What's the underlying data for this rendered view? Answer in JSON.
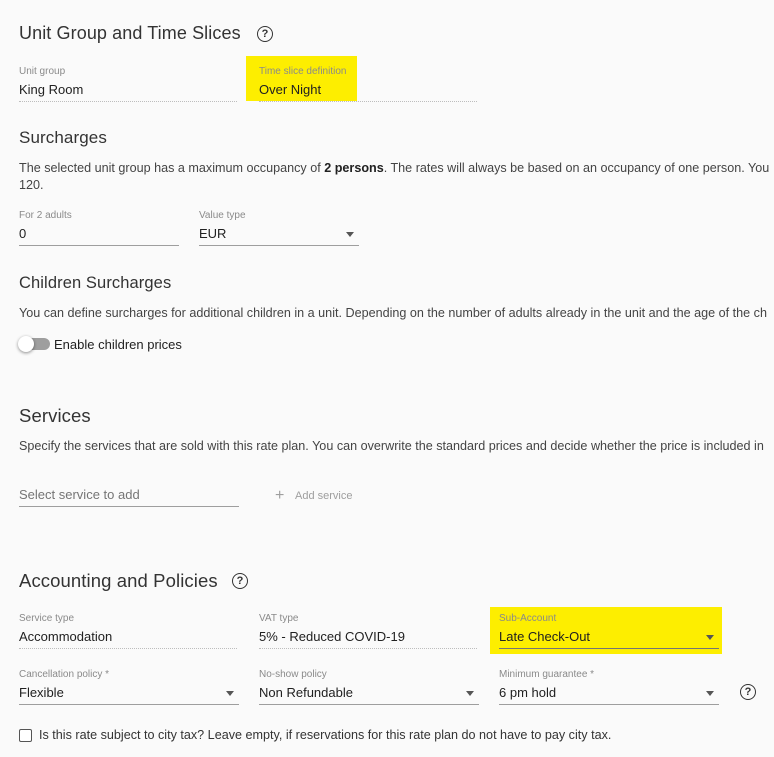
{
  "unit_group_section": {
    "title": "Unit Group and Time Slices",
    "help_icon": "help-circle-icon",
    "unit_group": {
      "label": "Unit group",
      "value": "King Room"
    },
    "time_slice": {
      "label": "Time slice definition",
      "value": "Over Night"
    }
  },
  "surcharges": {
    "title": "Surcharges",
    "desc_before": "The selected unit group has a maximum occupancy of ",
    "desc_bold": "2 persons",
    "desc_after": ". The rates will always be based on an occupancy of one person. You",
    "desc_line2": "120.",
    "for_adults": {
      "label": "For 2 adults",
      "value": "0"
    },
    "value_type": {
      "label": "Value type",
      "value": "EUR"
    }
  },
  "children_surcharges": {
    "title": "Children Surcharges",
    "desc": "You can define surcharges for additional children in a unit. Depending on the number of adults already in the unit and the age of the ch",
    "toggle_label": "Enable children prices"
  },
  "services": {
    "title": "Services",
    "desc": "Specify the services that are sold with this rate plan. You can overwrite the standard prices and decide whether the price is included in",
    "select_placeholder": "Select service to add",
    "add_button": "Add service",
    "add_icon": "plus-icon"
  },
  "accounting": {
    "title": "Accounting and Policies",
    "help_icon": "help-circle-icon",
    "service_type": {
      "label": "Service type",
      "value": "Accommodation"
    },
    "vat_type": {
      "label": "VAT type",
      "value": "5% - Reduced COVID-19"
    },
    "sub_account": {
      "label": "Sub-Account",
      "value": "Late Check-Out"
    },
    "cancellation": {
      "label": "Cancellation policy *",
      "value": "Flexible"
    },
    "no_show": {
      "label": "No-show policy",
      "value": "Non Refundable"
    },
    "min_guarantee": {
      "label": "Minimum guarantee *",
      "value": "6 pm hold"
    },
    "city_tax_label": "Is this rate subject to city tax? Leave empty, if reservations for this rate plan do not have to pay city tax.",
    "city_tax_checked": false
  },
  "colors": {
    "highlight": "#fdee00",
    "background": "#fafafa"
  }
}
